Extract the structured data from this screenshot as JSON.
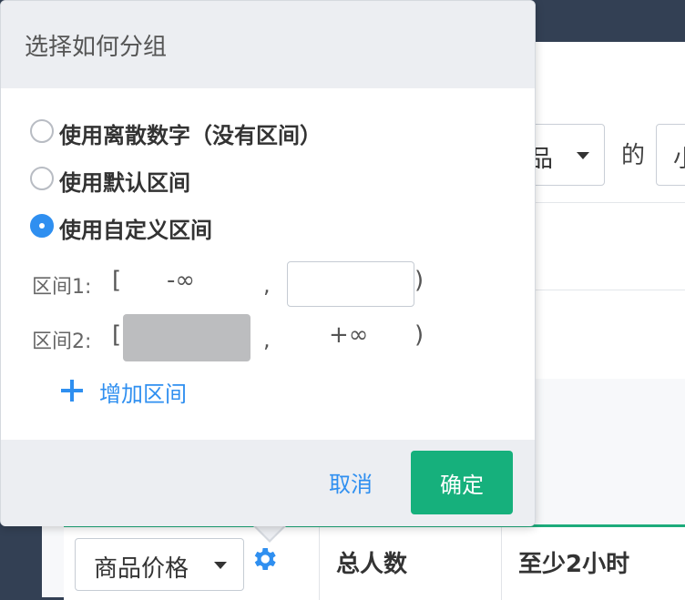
{
  "background": {
    "select_text": "品",
    "connector": "的",
    "select2_text": "小"
  },
  "table": {
    "group_select": "商品价格",
    "col2": "总人数",
    "col3": "至少2小时"
  },
  "popover": {
    "title": "选择如何分组",
    "options": [
      {
        "label": "使用离散数字（没有区间）",
        "selected": false
      },
      {
        "label": "使用默认区间",
        "selected": false
      },
      {
        "label": "使用自定义区间",
        "selected": true
      }
    ],
    "intervals": [
      {
        "label": "区间1:",
        "open": "[",
        "lower": "-∞",
        "sep": ",",
        "upper_value": "",
        "close": ")"
      },
      {
        "label": "区间2:",
        "open": "[",
        "lower_value": "",
        "sep": ",",
        "upper": "+∞",
        "close": ")"
      }
    ],
    "add_interval": "增加区间",
    "cancel": "取消",
    "confirm": "确定"
  },
  "colors": {
    "accent": "#2f8ff0",
    "confirm": "#16b07c",
    "table_top": "#1dab7b"
  }
}
